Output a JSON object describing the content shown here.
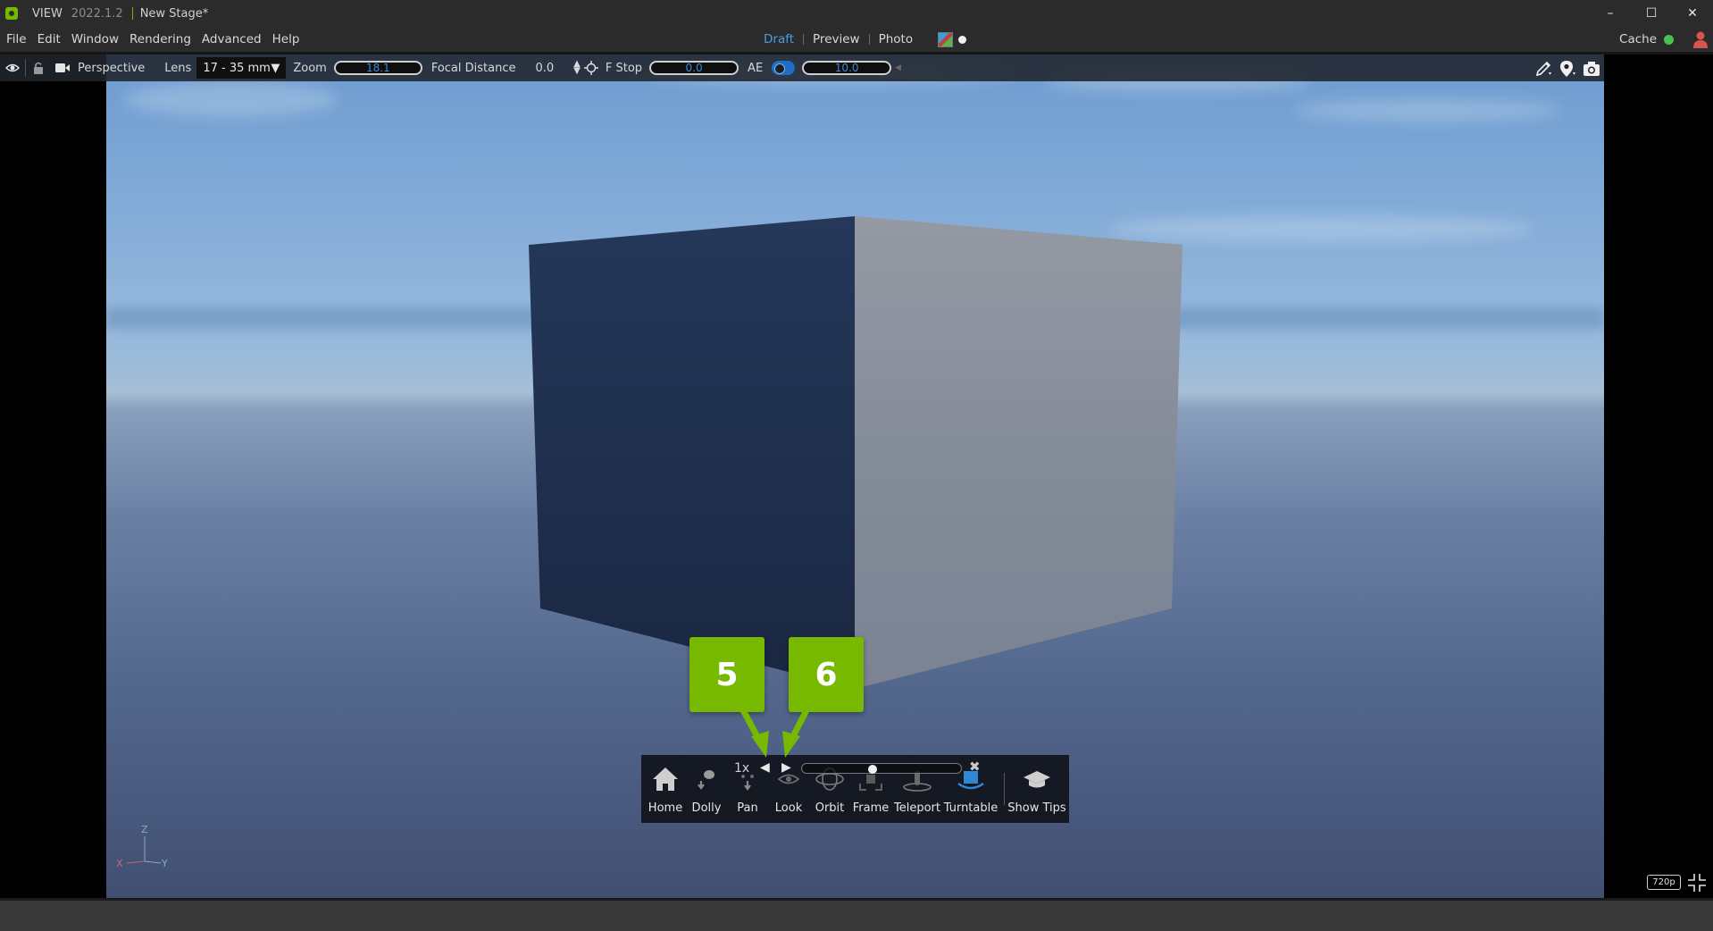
{
  "titlebar": {
    "app_name": "VIEW",
    "version": "2022.1.2",
    "stage": "New Stage*",
    "minimize": "–",
    "maximize": "☐",
    "close": "✕"
  },
  "menu": {
    "items": [
      "File",
      "Edit",
      "Window",
      "Rendering",
      "Advanced",
      "Help"
    ],
    "render_modes": [
      "Draft",
      "Preview",
      "Photo"
    ],
    "active_mode": "Draft",
    "cache_label": "Cache",
    "cache_status_color": "#47c24c"
  },
  "viewport_toolbar": {
    "camera": "Perspective",
    "lens_label": "Lens",
    "lens_value": "17 - 35 mm",
    "zoom_label": "Zoom",
    "zoom_value": "18.1",
    "focal_label": "Focal Distance",
    "focal_value": "0.0",
    "fstop_label": "F Stop",
    "fstop_value": "0.0",
    "ae_label": "AE",
    "ae_on": true,
    "exposure_value": "10.0",
    "right_icons": [
      "pencil-icon",
      "map-pin-icon",
      "camera-icon"
    ]
  },
  "navigation": {
    "speed": "1x",
    "items": [
      {
        "label": "Home",
        "icon": "home-icon"
      },
      {
        "label": "Dolly",
        "icon": "dolly-icon"
      },
      {
        "label": "Pan",
        "icon": "pan-icon"
      },
      {
        "label": "Look",
        "icon": "look-icon"
      },
      {
        "label": "Orbit",
        "icon": "orbit-icon"
      },
      {
        "label": "Frame",
        "icon": "frame-icon"
      },
      {
        "label": "Teleport",
        "icon": "teleport-icon"
      },
      {
        "label": "Turntable",
        "icon": "turntable-icon"
      },
      {
        "label": "Show Tips",
        "icon": "graduation-cap-icon"
      }
    ]
  },
  "callouts": [
    "5",
    "6"
  ],
  "axes": {
    "x": "X",
    "y": "Y",
    "z": "Z"
  },
  "resolution": "720p",
  "colors": {
    "accent": "#76b900",
    "active_blue": "#4d9be0"
  }
}
